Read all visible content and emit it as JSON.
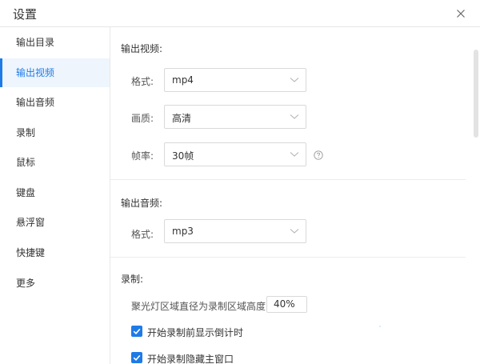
{
  "window": {
    "title": "设置"
  },
  "sidebar": {
    "items": [
      {
        "label": "输出目录"
      },
      {
        "label": "输出视频",
        "active": true
      },
      {
        "label": "输出音频"
      },
      {
        "label": "录制"
      },
      {
        "label": "鼠标"
      },
      {
        "label": "键盘"
      },
      {
        "label": "悬浮窗"
      },
      {
        "label": "快捷键"
      },
      {
        "label": "更多"
      }
    ]
  },
  "video_section": {
    "title": "输出视频:",
    "format_label": "格式:",
    "format_value": "mp4",
    "quality_label": "画质:",
    "quality_value": "高清",
    "fps_label": "帧率:",
    "fps_value": "30帧"
  },
  "audio_section": {
    "title": "输出音频:",
    "format_label": "格式:",
    "format_value": "mp3"
  },
  "record_section": {
    "title": "录制:",
    "spotlight_label": "聚光灯区域直径为录制区域高度",
    "spotlight_value": "40%",
    "countdown_label": "开始录制前显示倒计时",
    "countdown_checked": true,
    "hide_window_label": "开始录制隐藏主窗口",
    "hide_window_checked": true
  },
  "colors": {
    "accent": "#1e7be6",
    "active_bg": "#eef5fd",
    "border": "#d9d9d9",
    "divider": "#ececec"
  },
  "icons": {
    "close": "close-icon",
    "chevron": "chevron-down-icon",
    "help": "help-circle-icon",
    "check": "check-icon"
  }
}
